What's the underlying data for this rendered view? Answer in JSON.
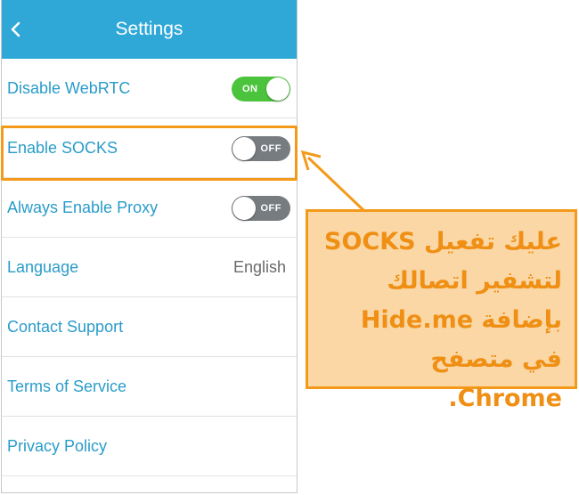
{
  "header": {
    "title": "Settings",
    "back_icon": "chevron-left-icon"
  },
  "settings": [
    {
      "label": "Disable WebRTC",
      "control": "toggle",
      "state": "on",
      "state_label": "ON"
    },
    {
      "label": "Enable SOCKS",
      "control": "toggle",
      "state": "off",
      "state_label": "OFF"
    },
    {
      "label": "Always Enable Proxy",
      "control": "toggle",
      "state": "off",
      "state_label": "OFF"
    },
    {
      "label": "Language",
      "control": "value",
      "value": "English"
    },
    {
      "label": "Contact Support",
      "control": "link"
    },
    {
      "label": "Terms of Service",
      "control": "link"
    },
    {
      "label": "Privacy Policy",
      "control": "link"
    }
  ],
  "callout": {
    "text": "عليك تفعيل SOCKS لتشفير اتصالك بإضافة Hide.me في متصفح Chrome."
  },
  "colors": {
    "header_bg": "#2fa8d8",
    "label": "#2a9cc9",
    "toggle_on": "#4cc33d",
    "toggle_off": "#777c80",
    "annotation": "#f39a1a",
    "callout_bg": "#fad7a5"
  }
}
